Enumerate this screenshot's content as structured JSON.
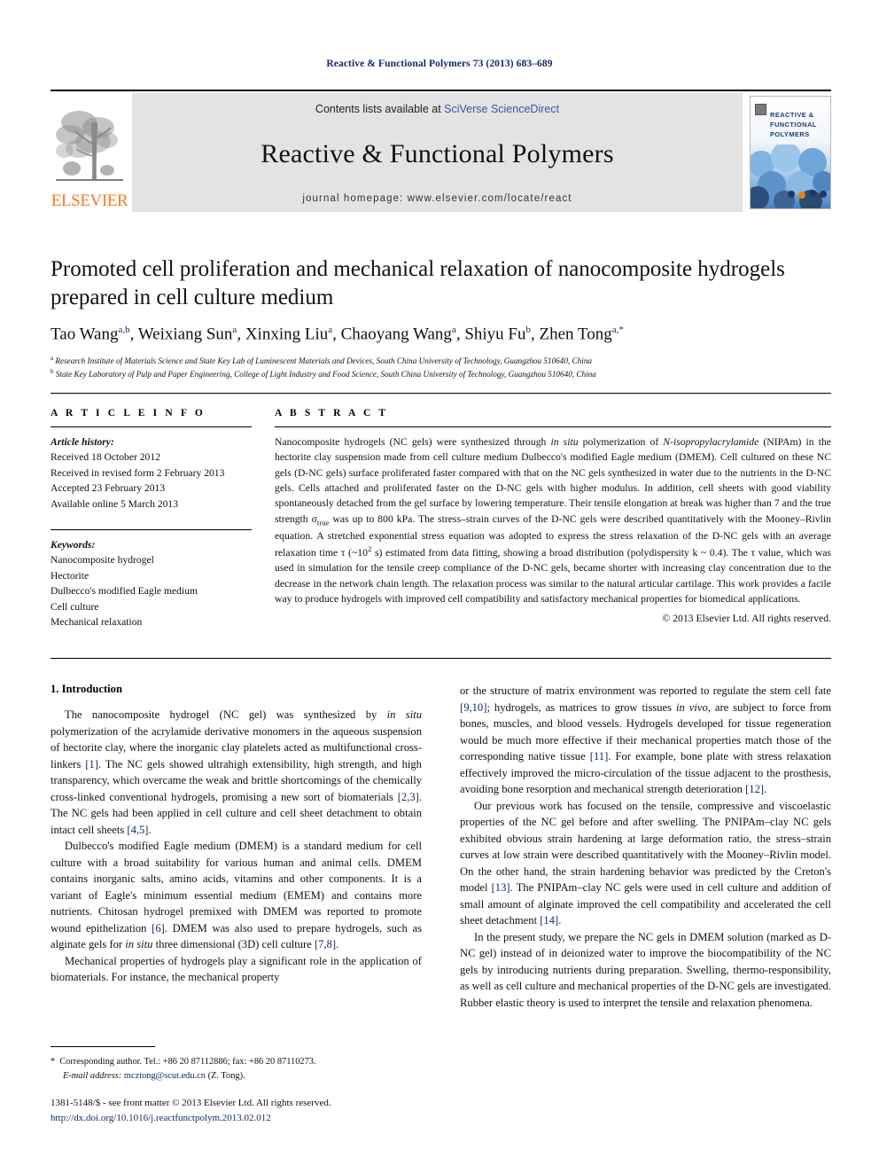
{
  "running_head": "Reactive & Functional Polymers 73 (2013) 683–689",
  "masthead": {
    "publisher_name": "ELSEVIER",
    "contents_prefix": "Contents lists available at ",
    "contents_link": "SciVerse ScienceDirect",
    "journal_title": "Reactive & Functional Polymers",
    "homepage_line": "journal homepage: www.elsevier.com/locate/react",
    "cover_title_line1": "REACTIVE &",
    "cover_title_line2": "FUNCTIONAL",
    "cover_title_line3": "POLYMERS"
  },
  "article": {
    "title": "Promoted cell proliferation and mechanical relaxation of nanocomposite hydrogels prepared in cell culture medium",
    "authors_html": "Tao Wang<sup>a,b</sup>, Weixiang Sun<sup>a</sup>, Xinxing Liu<sup>a</sup>, Chaoyang Wang<sup>a</sup>, Shiyu Fu<sup>b</sup>, Zhen Tong<sup>a,*</sup>",
    "affiliation_a": "Research Institute of Materials Science and State Key Lab of Luminescent Materials and Devices, South China University of Technology, Guangzhou 510640, China",
    "affiliation_b": "State Key Laboratory of Pulp and Paper Engineering, College of Light Industry and Food Science, South China University of Technology, Guangzhou 510640, China"
  },
  "info": {
    "section_label": "A R T I C L E    I N F O",
    "history_heading": "Article history:",
    "history": [
      "Received 18 October 2012",
      "Received in revised form 2 February 2013",
      "Accepted 23 February 2013",
      "Available online 5 March 2013"
    ],
    "keywords_heading": "Keywords:",
    "keywords": [
      "Nanocomposite hydrogel",
      "Hectorite",
      "Dulbecco's modified Eagle medium",
      "Cell culture",
      "Mechanical relaxation"
    ]
  },
  "abstract": {
    "section_label": "A B S T R A C T",
    "text": "Nanocomposite hydrogels (NC gels) were synthesized through in situ polymerization of N-isopropylacrylamide (NIPAm) in the hectorite clay suspension made from cell culture medium Dulbecco's modified Eagle medium (DMEM). Cell cultured on these NC gels (D-NC gels) surface proliferated faster compared with that on the NC gels synthesized in water due to the nutrients in the D-NC gels. Cells attached and proliferated faster on the D-NC gels with higher modulus. In addition, cell sheets with good viability spontaneously detached from the gel surface by lowering temperature. Their tensile elongation at break was higher than 7 and the true strength σtrue was up to 800 kPa. The stress–strain curves of the D-NC gels were described quantitatively with the Mooney–Rivlin equation. A stretched exponential stress equation was adopted to express the stress relaxation of the D-NC gels with an average relaxation time τ (~10² s) estimated from data fitting, showing a broad distribution (polydispersity k ~ 0.4). The τ value, which was used in simulation for the tensile creep compliance of the D-NC gels, became shorter with increasing clay concentration due to the decrease in the network chain length. The relaxation process was similar to the natural articular cartilage. This work provides a facile way to produce hydrogels with improved cell compatibility and satisfactory mechanical properties for biomedical applications.",
    "copyright": "© 2013 Elsevier Ltd. All rights reserved."
  },
  "body": {
    "intro_heading": "1. Introduction",
    "left_paragraphs": [
      "The nanocomposite hydrogel (NC gel) was synthesized by in situ polymerization of the acrylamide derivative monomers in the aqueous suspension of hectorite clay, where the inorganic clay platelets acted as multifunctional cross-linkers [1]. The NC gels showed ultrahigh extensibility, high strength, and high transparency, which overcame the weak and brittle shortcomings of the chemically cross-linked conventional hydrogels, promising a new sort of biomaterials [2,3]. The NC gels had been applied in cell culture and cell sheet detachment to obtain intact cell sheets [4,5].",
      "Dulbecco's modified Eagle medium (DMEM) is a standard medium for cell culture with a broad suitability for various human and animal cells. DMEM contains inorganic salts, amino acids, vitamins and other components. It is a variant of Eagle's minimum essential medium (EMEM) and contains more nutrients. Chitosan hydrogel premixed with DMEM was reported to promote wound epithelization [6]. DMEM was also used to prepare hydrogels, such as alginate gels for in situ three dimensional (3D) cell culture [7,8].",
      "Mechanical properties of hydrogels play a significant role in the application of biomaterials. For instance, the mechanical property"
    ],
    "right_paragraphs": [
      "or the structure of matrix environment was reported to regulate the stem cell fate [9,10]; hydrogels, as matrices to grow tissues in vivo, are subject to force from bones, muscles, and blood vessels. Hydrogels developed for tissue regeneration would be much more effective if their mechanical properties match those of the corresponding native tissue [11]. For example, bone plate with stress relaxation effectively improved the micro-circulation of the tissue adjacent to the prosthesis, avoiding bone resorption and mechanical strength deterioration [12].",
      "Our previous work has focused on the tensile, compressive and viscoelastic properties of the NC gel before and after swelling. The PNIPAm–clay NC gels exhibited obvious strain hardening at large deformation ratio, the stress–strain curves at low strain were described quantitatively with the Mooney–Rivlin model. On the other hand, the strain hardening behavior was predicted by the Creton's model [13]. The PNIPAm–clay NC gels were used in cell culture and addition of small amount of alginate improved the cell compatibility and accelerated the cell sheet detachment [14].",
      "In the present study, we prepare the NC gels in DMEM solution (marked as D-NC gel) instead of in deionized water to improve the biocompatibility of the NC gels by introducing nutrients during preparation. Swelling, thermo-responsibility, as well as cell culture and mechanical properties of the D-NC gels are investigated. Rubber elastic theory is used to interpret the tensile and relaxation phenomena."
    ]
  },
  "footer": {
    "corresponding_star": "*",
    "corresponding_text": "Corresponding author. Tel.: +86 20 87112886; fax: +86 20 87110273.",
    "email_label": "E-mail address:",
    "email": "mcztong@scut.edu.cn",
    "email_suffix": "(Z. Tong).",
    "imprint_line": "1381-5148/$ - see front matter © 2013 Elsevier Ltd. All rights reserved.",
    "doi": "http://dx.doi.org/10.1016/j.reactfunctpolym.2013.02.012"
  },
  "colors": {
    "link_blue": "#14296b",
    "sciencedirect_blue": "#3259a8",
    "elsevier_orange": "#f27c21",
    "masthead_grey": "#e3e3e3"
  }
}
